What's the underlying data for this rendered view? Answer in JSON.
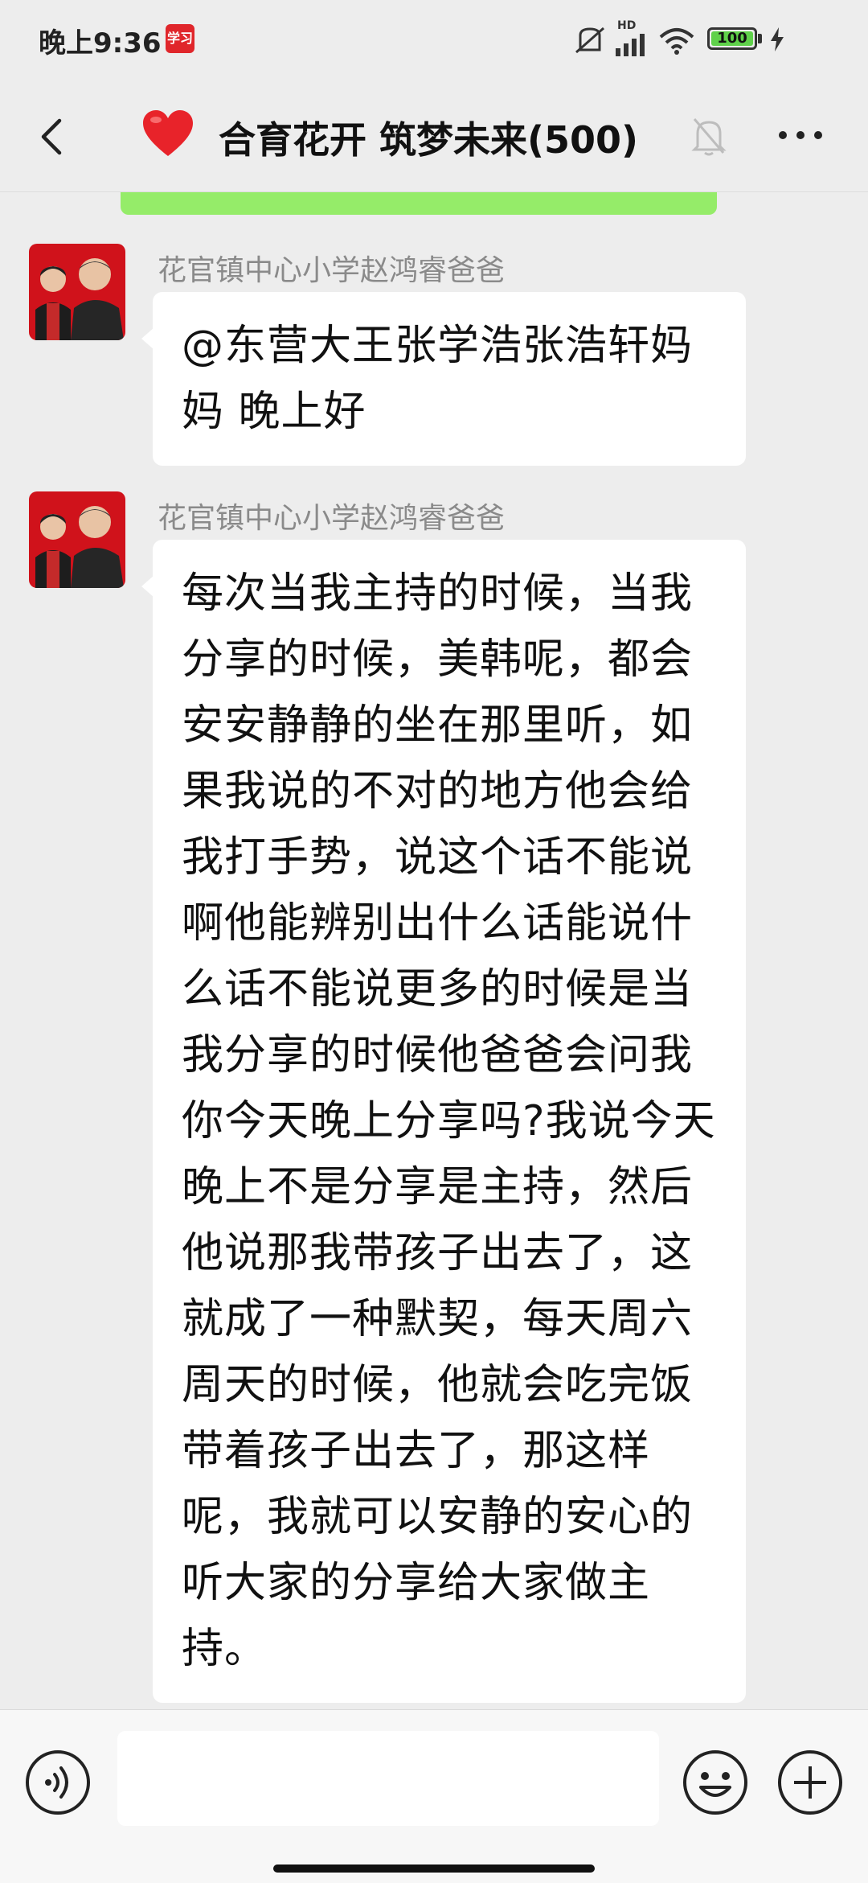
{
  "status_bar": {
    "time": "晚上9:36",
    "app_icon": "学习",
    "network": "HD",
    "battery": "100",
    "icons": [
      "vibrate-off-icon",
      "signal-icon",
      "wifi-icon",
      "battery-icon",
      "charging-icon"
    ]
  },
  "header": {
    "back_icon": "chevron-left-icon",
    "emoji": "heart-icon",
    "title": "合育花开 筑梦未来(500)",
    "mute_icon": "bell-off-icon",
    "more_icon": "more-icon"
  },
  "messages": [
    {
      "sender": "花官镇中心小学赵鸿睿爸爸",
      "text": "@东营大王张学浩张浩轩妈妈  晚上好"
    },
    {
      "sender": "花官镇中心小学赵鸿睿爸爸",
      "text": "每次当我主持的时候，当我分享的时候，美韩呢，都会安安静静的坐在那里听，如果我说的不对的地方他会给我打手势，说这个话不能说啊他能辨别出什么话能说什么话不能说更多的时候是当我分享的时候他爸爸会问我你今天晚上分享吗?我说今天晚上不是分享是主持，然后他说那我带孩子出去了，这就成了一种默契，每天周六周天的时候，他就会吃完饭带着孩子出去了，那这样呢，我就可以安静的安心的听大家的分享给大家做主持。"
    }
  ],
  "input_bar": {
    "value": "",
    "voice_icon": "voice-icon",
    "emoji_icon": "emoji-icon",
    "plus_icon": "plus-icon"
  },
  "colors": {
    "background": "#ededed",
    "bubble": "#ffffff",
    "accent_green": "#95ec69",
    "sender_gray": "#8a8a8a"
  }
}
